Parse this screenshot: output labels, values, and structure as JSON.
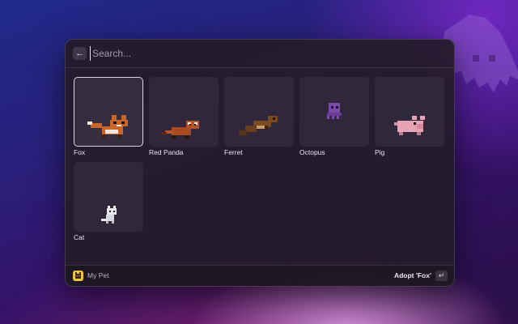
{
  "search": {
    "placeholder": "Search...",
    "value": ""
  },
  "pets": [
    {
      "name": "Fox",
      "selected": true
    },
    {
      "name": "Red Panda",
      "selected": false
    },
    {
      "name": "Ferret",
      "selected": false
    },
    {
      "name": "Octopus",
      "selected": false
    },
    {
      "name": "Pig",
      "selected": false
    },
    {
      "name": "Cat",
      "selected": false
    }
  ],
  "footer": {
    "app_title": "My Pet",
    "action_label": "Adopt 'Fox'",
    "back_icon": "arrow-left-icon",
    "enter_icon": "return-key-icon"
  },
  "colors": {
    "app_icon": "#f0c43c",
    "fox": "#c8652a",
    "red_panda": "#b5532a",
    "ferret": "#7a4a22",
    "octopus": "#7a4aa8",
    "pig": "#e7a3b6",
    "cat": "#e8e8ea"
  }
}
